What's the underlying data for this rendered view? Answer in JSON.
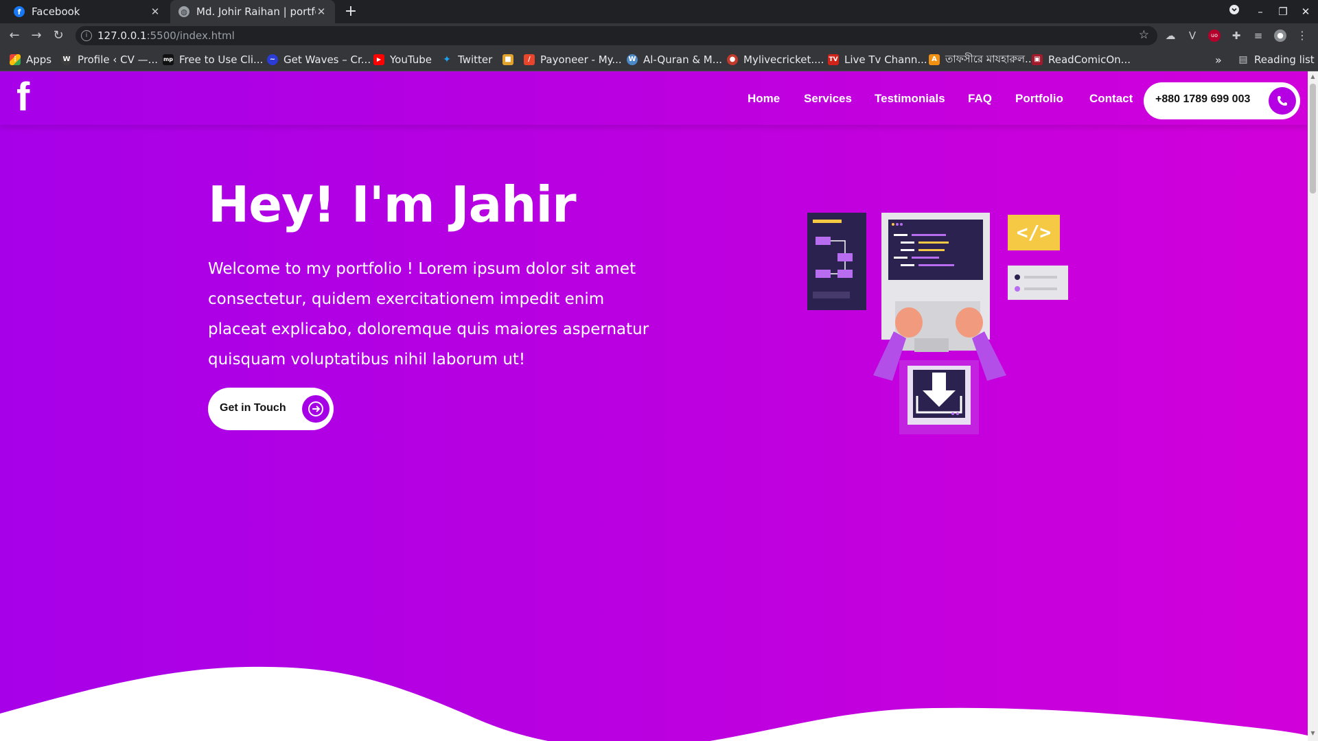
{
  "browser": {
    "tabs": [
      {
        "title": "Facebook",
        "favicon": "facebook-icon",
        "active": false
      },
      {
        "title": "Md. Johir Raihan | portfol",
        "favicon": "globe-icon",
        "active": true
      }
    ],
    "address": {
      "host": "127.0.0.1",
      "rest": ":5500/index.html"
    },
    "bookmarks": [
      {
        "label": "Apps",
        "icon": "apps-grid-icon"
      },
      {
        "label": "Profile ‹ CV —...",
        "icon": "wordpress-icon"
      },
      {
        "label": "Free to Use Cli...",
        "icon": "mp-icon"
      },
      {
        "label": "Get Waves – Cr...",
        "icon": "waves-icon"
      },
      {
        "label": "YouTube",
        "icon": "youtube-icon"
      },
      {
        "label": "Twitter",
        "icon": "twitter-icon"
      },
      {
        "label": "",
        "icon": "box-icon"
      },
      {
        "label": "Payoneer - My...",
        "icon": "payoneer-icon"
      },
      {
        "label": "Al-Quran & M...",
        "icon": "wordpress-icon"
      },
      {
        "label": "Mylivecricket....",
        "icon": "cricket-icon"
      },
      {
        "label": "Live Tv Chann...",
        "icon": "tv-icon"
      },
      {
        "label": "তাফসীরে মাযহারুল...",
        "icon": "a-icon"
      },
      {
        "label": "ReadComicOn...",
        "icon": "comic-icon"
      }
    ],
    "more_bookmarks": "»",
    "reading_list": "Reading list"
  },
  "site": {
    "logo": "f",
    "nav": [
      "Home",
      "Services",
      "Testimonials",
      "FAQ",
      "Portfolio",
      "Contact"
    ],
    "phone": "+880 1789 699 003",
    "hero": {
      "title": "Hey! I'm Jahir",
      "text": "Welcome to my portfolio ! Lorem ipsum dolor sit amet consectetur, quidem exercitationem impedit enim placeat explicabo, doloremque quis maiores aspernatur quisquam voluptatibus nihil laborum ut!",
      "cta": "Get in Touch",
      "code_badge": "</>"
    }
  },
  "colors": {
    "gradient_start": "#a700e8",
    "gradient_end": "#d100da",
    "accent": "#b400e3",
    "badge_yellow": "#f6c945",
    "panel_dark": "#2c2250"
  }
}
